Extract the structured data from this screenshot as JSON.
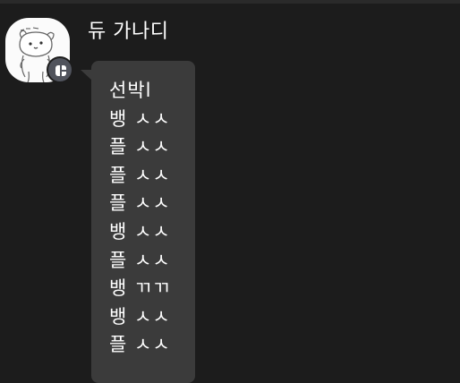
{
  "sender": {
    "name": "듀 가나디"
  },
  "message": {
    "lines": [
      "선박l",
      "뱅 ㅅㅅ",
      "플 ㅅㅅ",
      "플 ㅅㅅ",
      "플 ㅅㅅ",
      "뱅 ㅅㅅ",
      "플 ㅅㅅ",
      "뱅 ㄲㄲ",
      "뱅 ㅅㅅ",
      "플 ㅅㅅ"
    ]
  },
  "icons": {
    "avatar": "cartoon-dog-avatar",
    "badge": "profile-badge-icon"
  },
  "colors": {
    "background": "#1c1c1c",
    "bubble": "#3b3b3b",
    "badge": "#50535c",
    "text": "#ffffff"
  }
}
